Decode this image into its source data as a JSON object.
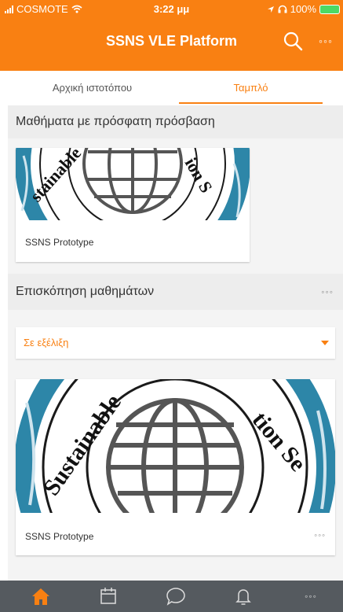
{
  "status_bar": {
    "carrier": "COSMOTE",
    "time": "3:22 μμ",
    "battery": "100%"
  },
  "appbar": {
    "title": "SSNS VLE Platform",
    "more_label": "◦◦◦"
  },
  "tabs": [
    {
      "label": "Αρχική ιστοτόπου",
      "active": false
    },
    {
      "label": "Ταμπλό",
      "active": true
    }
  ],
  "recent_courses": {
    "heading": "Μαθήματα με πρόσφατη πρόσβαση",
    "items": [
      {
        "title": "SSNS Prototype"
      }
    ]
  },
  "overview": {
    "heading": "Επισκόπηση μαθημάτων",
    "more_label": "◦◦◦",
    "filter": {
      "selected": "Σε εξέλιξη"
    },
    "courses": [
      {
        "title": "SSNS Prototype",
        "more_label": "◦◦◦"
      }
    ]
  },
  "bottom_nav": {
    "items": [
      "home-icon",
      "calendar-icon",
      "messages-icon",
      "notifications-icon",
      "more-icon"
    ],
    "more_label": "◦◦◦"
  },
  "colors": {
    "accent": "#f98012",
    "navbar": "#555a5f",
    "section_bg": "#ededed"
  },
  "logo_text": "Sustainable Seafood Nutrition Security"
}
